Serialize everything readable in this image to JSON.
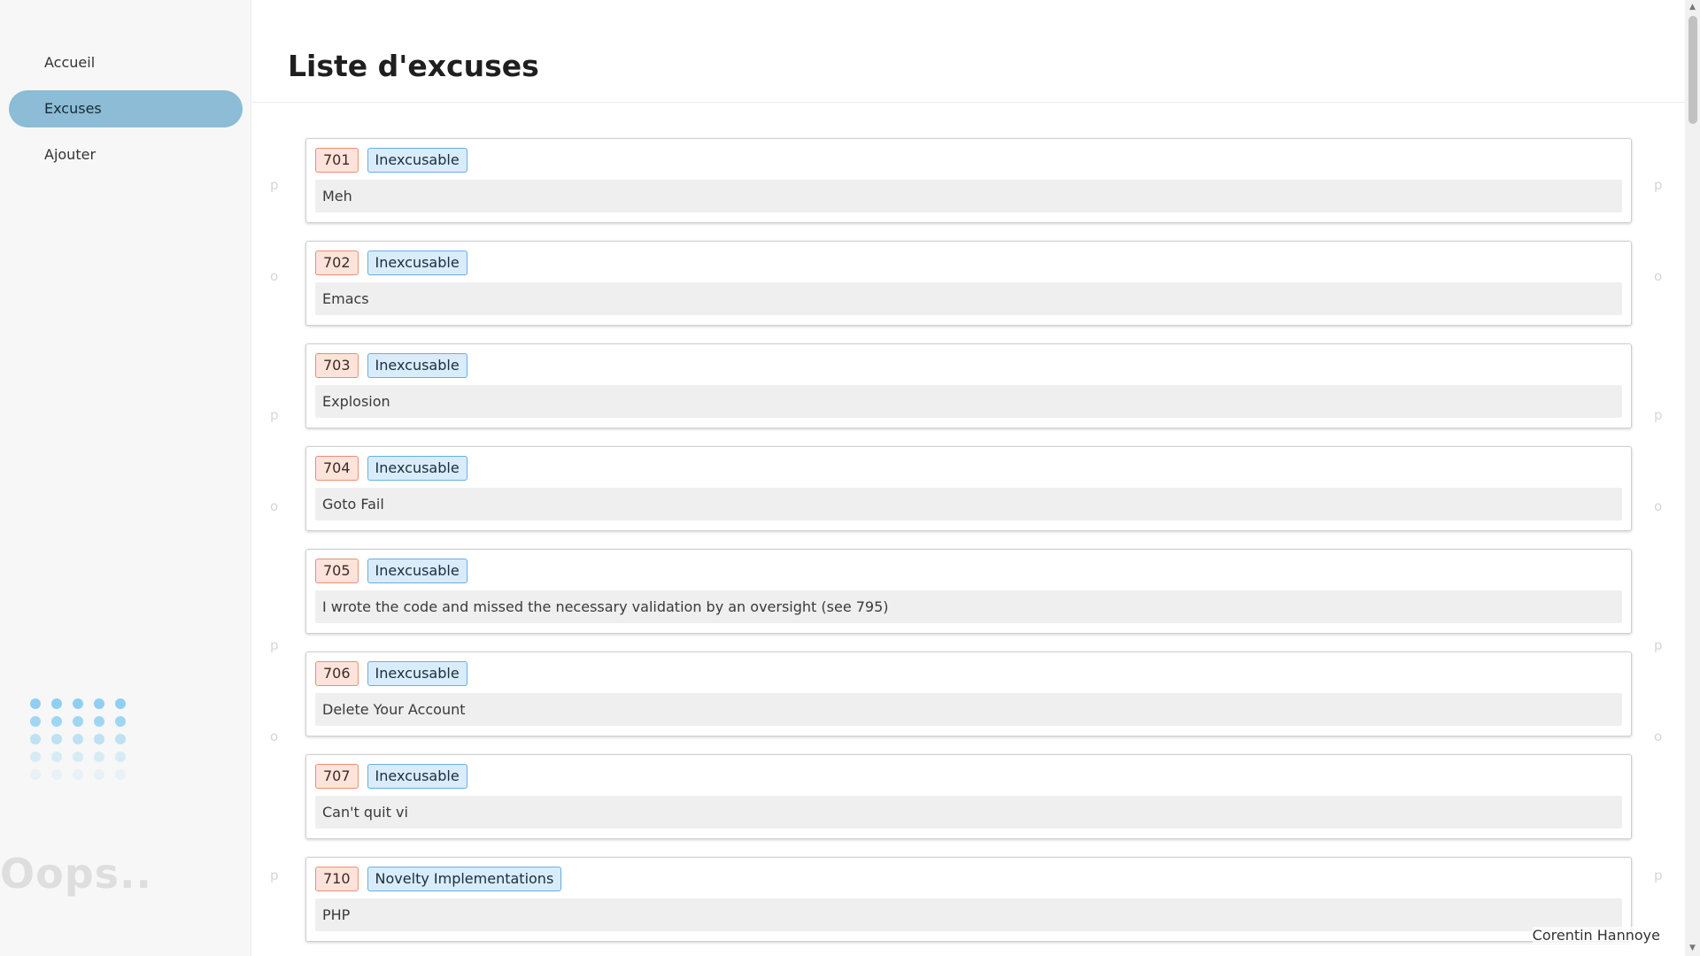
{
  "sidebar": {
    "items": [
      {
        "label": "Accueil"
      },
      {
        "label": "Excuses"
      },
      {
        "label": "Ajouter"
      }
    ],
    "active_index": 1,
    "decoration_text": "Oops.."
  },
  "header": {
    "title": "Liste d'excuses"
  },
  "excuses": [
    {
      "id": "701",
      "tag": "Inexcusable",
      "text": "Meh"
    },
    {
      "id": "702",
      "tag": "Inexcusable",
      "text": "Emacs"
    },
    {
      "id": "703",
      "tag": "Inexcusable",
      "text": "Explosion"
    },
    {
      "id": "704",
      "tag": "Inexcusable",
      "text": "Goto Fail"
    },
    {
      "id": "705",
      "tag": "Inexcusable",
      "text": "I wrote the code and missed the necessary validation by an oversight (see 795)"
    },
    {
      "id": "706",
      "tag": "Inexcusable",
      "text": "Delete Your Account"
    },
    {
      "id": "707",
      "tag": "Inexcusable",
      "text": "Can't quit vi"
    },
    {
      "id": "710",
      "tag": "Novelty Implementations",
      "text": "PHP"
    }
  ],
  "footer": {
    "author": "Corentin Hannoye"
  },
  "colors": {
    "active_nav": "#8cbcd6",
    "id_badge_bg": "#fde3da",
    "id_badge_border": "#ea8f74",
    "tag_badge_bg": "#d9ecfb",
    "tag_badge_border": "#6aaee3",
    "dots": "#8fd0f2"
  }
}
